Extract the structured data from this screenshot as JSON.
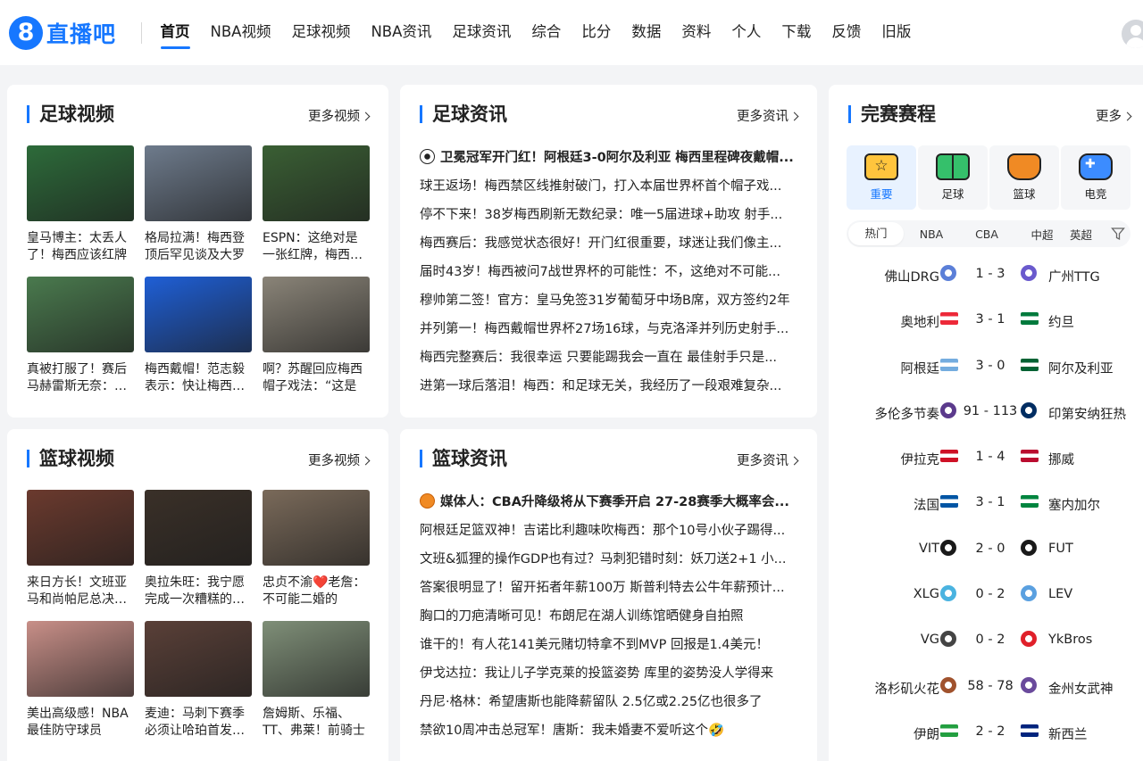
{
  "brand": {
    "badge": "8",
    "name": "直播吧"
  },
  "nav": [
    "首页",
    "NBA视频",
    "足球视频",
    "NBA资讯",
    "足球资讯",
    "综合",
    "比分",
    "数据",
    "资料",
    "个人",
    "下载",
    "反馈",
    "旧版"
  ],
  "football_video": {
    "title": "足球视频",
    "more": "更多视频",
    "items": [
      {
        "caption": "皇马博主：太丢人了！梅西应该红牌",
        "thumb_color": "#2d6b3a"
      },
      {
        "caption": "格局拉满！梅西登顶后罕见谈及大罗",
        "thumb_color": "#6e7b8c"
      },
      {
        "caption": "ESPN：这绝对是一张红牌，梅西必须",
        "thumb_color": "#3a5f34"
      },
      {
        "caption": "真被打服了！赛后马赫雷斯无奈：梅西",
        "thumb_color": "#4a7a4e"
      },
      {
        "caption": "梅西戴帽！范志毅表示：快让梅西休息",
        "thumb_color": "#1f5fd6"
      },
      {
        "caption": "啊？苏醒回应梅西帽子戏法：“这是",
        "thumb_color": "#8a8478"
      }
    ]
  },
  "football_news": {
    "title": "足球资讯",
    "more": "更多资讯",
    "headline": "卫冕冠军开门红！阿根廷3-0阿尔及利亚 梅西里程碑夜戴帽...",
    "items": [
      "球王返场！梅西禁区线推射破门，打入本届世界杯首个帽子戏...",
      "停不下来！38岁梅西刷新无数纪录：唯一5届进球+助攻 射手...",
      "梅西赛后：我感觉状态很好！开门红很重要，球迷让我们像主...",
      "届时43岁！梅西被问7战世界杯的可能性：不，这绝对不可能...",
      "穆帅第二签！官方：皇马免签31岁葡萄牙中场B席，双方签约2年",
      "并列第一！梅西戴帽世界杯27场16球，与克洛泽并列历史射手...",
      "梅西完整赛后：我很幸运 只要能踢我会一直在 最佳射手只是...",
      "进第一球后落泪！梅西：和足球无关，我经历了一段艰难复杂..."
    ]
  },
  "basketball_video": {
    "title": "篮球视频",
    "more": "更多视频",
    "items": [
      {
        "caption": "来日方长！文班亚马和尚帕尼总决赛后",
        "thumb_color": "#6b3a2e"
      },
      {
        "caption": "奥拉朱旺：我宁愿完成一次糟糕的投篮",
        "thumb_color": "#3a3028"
      },
      {
        "caption": "忠贞不渝❤️老詹：不可能二婚的",
        "thumb_color": "#7a6a5a"
      },
      {
        "caption": "美出高级感！NBA最佳防守球员",
        "thumb_color": "#c88f88"
      },
      {
        "caption": "麦迪：马刺下赛季必须让哈珀首发上场",
        "thumb_color": "#5a4038"
      },
      {
        "caption": "詹姆斯、乐福、TT、弗莱！前骑士",
        "thumb_color": "#7f8f78"
      }
    ]
  },
  "basketball_news": {
    "title": "篮球资讯",
    "more": "更多资讯",
    "headline": "媒体人：CBA升降级将从下赛季开启 27-28赛季大概率会...",
    "items": [
      "阿根廷足篮双神！吉诺比利趣味吹梅西：那个10号小伙子踢得...",
      "文班&狐狸的操作GDP也有过？马刺犯错时刻：妖刀送2+1 小...",
      "答案很明显了！留开拓者年薪100万 斯普利特去公牛年薪预计...",
      "胸口的刀疤清晰可见！布朗尼在湖人训练馆晒健身自拍照",
      "谁干的！有人花141美元赌切特拿不到MVP 回报是1.4美元！",
      "伊戈达拉：我让儿子学克莱的投篮姿势 库里的姿势没人学得来",
      "丹尼·格林：希望唐斯也能降薪留队 2.5亿或2.25亿也很多了",
      "禁欲10周冲击总冠军！唐斯：我未婚妻不爱听这个🤣"
    ]
  },
  "schedule": {
    "title": "完赛赛程",
    "more": "更多",
    "sport_tabs": [
      {
        "label": "重要",
        "icon": "star-icon"
      },
      {
        "label": "足球",
        "icon": "football-field-icon"
      },
      {
        "label": "篮球",
        "icon": "basketball-hoop-icon"
      },
      {
        "label": "电竞",
        "icon": "gamepad-icon"
      }
    ],
    "filters": [
      "热门",
      "NBA",
      "CBA",
      "中超",
      "英超"
    ],
    "matches": [
      {
        "home": "佛山DRG",
        "score": "1 - 3",
        "away": "广州TTG",
        "home_color": "#5b7fd8",
        "away_color": "#6a5acd",
        "kind": "logo"
      },
      {
        "home": "奥地利",
        "score": "3 - 1",
        "away": "约旦",
        "home_color": "#ed2939",
        "away_color": "#007a3d",
        "kind": "flag"
      },
      {
        "home": "阿根廷",
        "score": "3 - 0",
        "away": "阿尔及利亚",
        "home_color": "#74acdf",
        "away_color": "#006233",
        "kind": "flag"
      },
      {
        "home": "多伦多节奏",
        "score": "91 - 113",
        "away": "印第安纳狂热",
        "home_color": "#5b3a8c",
        "away_color": "#002d62",
        "kind": "logo"
      },
      {
        "home": "伊拉克",
        "score": "1 - 4",
        "away": "挪威",
        "home_color": "#ce1126",
        "away_color": "#ba0c2f",
        "kind": "flag"
      },
      {
        "home": "法国",
        "score": "3 - 1",
        "away": "塞内加尔",
        "home_color": "#0055a4",
        "away_color": "#00853f",
        "kind": "flag"
      },
      {
        "home": "VIT",
        "score": "2 - 0",
        "away": "FUT",
        "home_color": "#1a1a1a",
        "away_color": "#1a1a1a",
        "kind": "logo"
      },
      {
        "home": "XLG",
        "score": "0 - 2",
        "away": "LEV",
        "home_color": "#4ab3e0",
        "away_color": "#5aa0e0",
        "kind": "logo"
      },
      {
        "home": "VG",
        "score": "0 - 2",
        "away": "YkBros",
        "home_color": "#444444",
        "away_color": "#e0202a",
        "kind": "logo"
      },
      {
        "home": "洛杉矶火花",
        "score": "58 - 78",
        "away": "金州女武神",
        "home_color": "#a0522d",
        "away_color": "#6a4a9c",
        "kind": "logo"
      },
      {
        "home": "伊朗",
        "score": "2 - 2",
        "away": "新西兰",
        "home_color": "#239f40",
        "away_color": "#00247d",
        "kind": "flag"
      }
    ]
  },
  "colors": {
    "accent": "#1677ff",
    "background": "#f3f4f6"
  }
}
